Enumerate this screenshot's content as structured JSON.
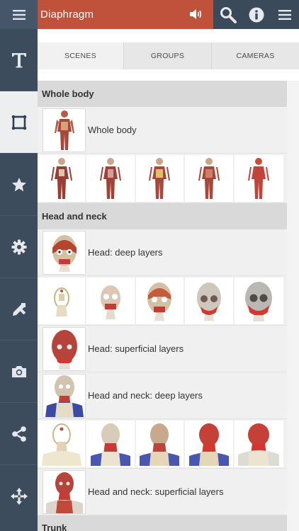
{
  "header": {
    "title": "Diaphragm",
    "icons": [
      "menu-icon",
      "speaker-icon",
      "search-icon",
      "info-icon",
      "hamburger-icon"
    ]
  },
  "sidebar": {
    "items": [
      {
        "name": "text-icon",
        "glyph": "T"
      },
      {
        "name": "scenes-icon",
        "active": true
      },
      {
        "name": "star-icon"
      },
      {
        "name": "settings-icon"
      },
      {
        "name": "draw-icon"
      },
      {
        "name": "camera-icon"
      },
      {
        "name": "share-icon"
      },
      {
        "name": "move-icon"
      }
    ]
  },
  "tabs": [
    {
      "label": "SCENES",
      "active": true
    },
    {
      "label": "GROUPS",
      "active": false
    },
    {
      "label": "CAMERAS",
      "active": false
    }
  ],
  "sections": [
    {
      "title": "Whole body"
    },
    {
      "title": "Head and neck"
    },
    {
      "title": "Trunk"
    }
  ],
  "scenes": {
    "whole_body": "Whole body",
    "head_deep": "Head: deep layers",
    "head_superficial": "Head: superficial layers",
    "head_neck_deep": "Head and neck: deep layers",
    "head_neck_superficial": "Head and neck: superficial layers"
  },
  "colors": {
    "accent": "#c0513b",
    "sidebar": "#3d4c5d",
    "section": "#d9d9d9"
  }
}
